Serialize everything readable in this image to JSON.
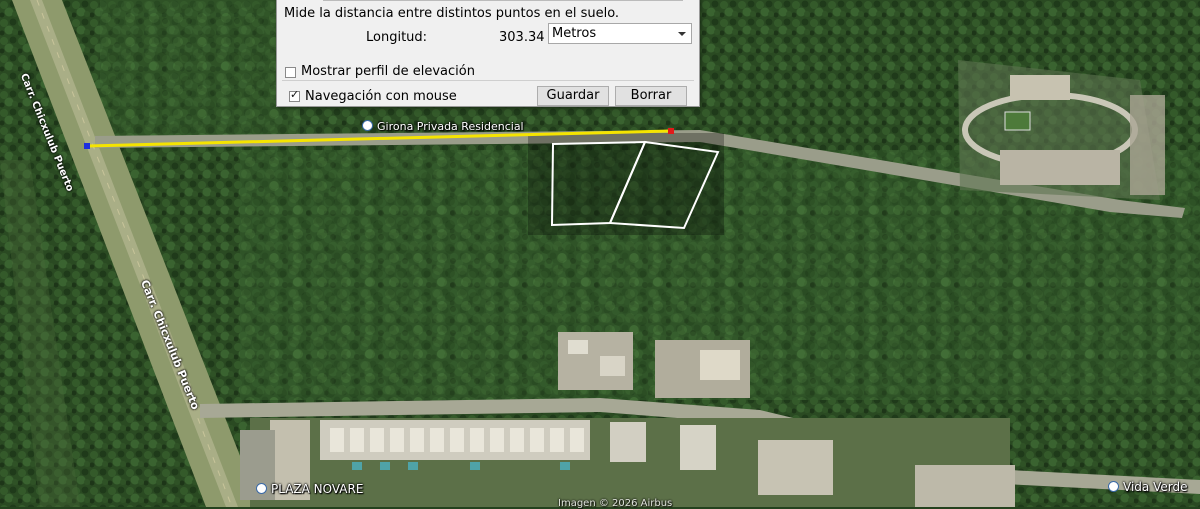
{
  "dialog": {
    "description": "Mide la distancia entre distintos puntos en el suelo.",
    "length_label": "Longitud:",
    "length_value": "303.34",
    "unit_selected": "Metros",
    "elevation_profile_label": "Mostrar perfil de elevación",
    "elevation_profile_checked": false,
    "mouse_nav_label": "Navegación con mouse",
    "mouse_nav_checked": true,
    "save_button": "Guardar",
    "clear_button": "Borrar"
  },
  "map": {
    "places": {
      "girona": "Girona Privada Residencial",
      "plaza_novare": "PLAZA NOVARE",
      "vida_verde": "Vida Verde"
    },
    "roads": {
      "top": "Carr. Chicxulub Puerto",
      "main": "Carr. Chicxulub Puerto"
    },
    "credit": "Imagen © 2026 Airbus",
    "ruler": {
      "line_color": "#f5e400",
      "start_color": "#1c2ee0",
      "end_color": "#e11a1a"
    }
  }
}
